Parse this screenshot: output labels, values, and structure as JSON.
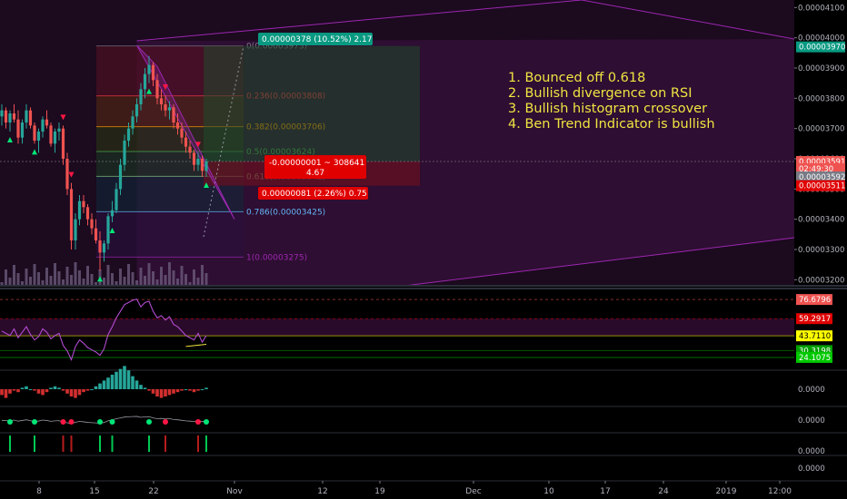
{
  "chart_data": {
    "type": "candlestick",
    "main_axis": {
      "ticks": [
        "0.00004100",
        "0.00004000",
        "0.00003900",
        "0.00003800",
        "0.00003700",
        "0.00003600",
        "0.00003500",
        "0.00003400",
        "0.00003300",
        "0.00003200"
      ],
      "tick_values": [
        4100,
        4000,
        3900,
        3800,
        3700,
        3600,
        3500,
        3400,
        3300,
        3200
      ],
      "scale_note": "values x1e-8"
    },
    "price_badges": [
      {
        "label": "0.00003970",
        "value": 3970,
        "color": "#089981"
      },
      {
        "label": "0.00003591",
        "value": 3591,
        "color": "#ef5350"
      },
      {
        "label": "02:49:30",
        "value": 3567,
        "color": "#ef5350"
      },
      {
        "label": "0.00003592",
        "value": 3540,
        "color": "#787b86"
      },
      {
        "label": "0.00003511",
        "value": 3511,
        "color": "#e00000"
      }
    ],
    "fib_levels": [
      {
        "label": "0(0.00003973)",
        "value": 3973,
        "color": "#787b86"
      },
      {
        "label": "0.236(0.00003808)",
        "value": 3808,
        "color": "#f23645"
      },
      {
        "label": "0.382(0.00003706)",
        "value": 3706,
        "color": "#ff9800"
      },
      {
        "label": "0.5(0.00003624)",
        "value": 3624,
        "color": "#4caf50"
      },
      {
        "label": "0.618(0.00003542)",
        "value": 3542,
        "color": "#81c784"
      },
      {
        "label": "0.786(0.00003425)",
        "value": 3425,
        "color": "#64b5f6"
      },
      {
        "label": "1(0.00003275)",
        "value": 3275,
        "color": "#9c27b0"
      }
    ],
    "position_tool": {
      "target_label": "0.00000378 (10.52%) 2.17",
      "stop_label": "0.00000081 (2.26%) 0.75",
      "ruler_label_line1": "-0.00000001 ~ 308641",
      "ruler_label_line2": "4.67",
      "entry": 3591,
      "target": 3973,
      "stop": 3511
    },
    "candles": [
      [
        3740,
        3780,
        3710,
        3760
      ],
      [
        3760,
        3770,
        3700,
        3720
      ],
      [
        3720,
        3760,
        3690,
        3750
      ],
      [
        3750,
        3780,
        3720,
        3730
      ],
      [
        3730,
        3760,
        3650,
        3670
      ],
      [
        3670,
        3730,
        3650,
        3720
      ],
      [
        3720,
        3780,
        3700,
        3760
      ],
      [
        3760,
        3770,
        3700,
        3710
      ],
      [
        3710,
        3720,
        3650,
        3660
      ],
      [
        3660,
        3700,
        3620,
        3690
      ],
      [
        3690,
        3740,
        3670,
        3730
      ],
      [
        3730,
        3760,
        3700,
        3710
      ],
      [
        3710,
        3720,
        3640,
        3650
      ],
      [
        3650,
        3700,
        3620,
        3690
      ],
      [
        3690,
        3720,
        3660,
        3700
      ],
      [
        3700,
        3710,
        3580,
        3600
      ],
      [
        3600,
        3620,
        3480,
        3500
      ],
      [
        3500,
        3520,
        3300,
        3330
      ],
      [
        3330,
        3420,
        3300,
        3400
      ],
      [
        3400,
        3480,
        3380,
        3460
      ],
      [
        3460,
        3480,
        3420,
        3440
      ],
      [
        3440,
        3450,
        3380,
        3400
      ],
      [
        3400,
        3420,
        3350,
        3370
      ],
      [
        3370,
        3400,
        3320,
        3330
      ],
      [
        3330,
        3360,
        3230,
        3290
      ],
      [
        3290,
        3330,
        3260,
        3320
      ],
      [
        3320,
        3420,
        3300,
        3410
      ],
      [
        3410,
        3460,
        3390,
        3430
      ],
      [
        3430,
        3520,
        3420,
        3500
      ],
      [
        3500,
        3600,
        3480,
        3580
      ],
      [
        3580,
        3680,
        3560,
        3660
      ],
      [
        3660,
        3720,
        3640,
        3700
      ],
      [
        3700,
        3760,
        3680,
        3740
      ],
      [
        3740,
        3800,
        3720,
        3780
      ],
      [
        3780,
        3850,
        3760,
        3830
      ],
      [
        3830,
        3900,
        3800,
        3880
      ],
      [
        3880,
        3940,
        3850,
        3910
      ],
      [
        3910,
        3920,
        3840,
        3860
      ],
      [
        3860,
        3880,
        3780,
        3800
      ],
      [
        3800,
        3830,
        3760,
        3780
      ],
      [
        3780,
        3810,
        3740,
        3760
      ],
      [
        3760,
        3790,
        3730,
        3770
      ],
      [
        3770,
        3780,
        3700,
        3720
      ],
      [
        3720,
        3750,
        3680,
        3700
      ],
      [
        3700,
        3720,
        3650,
        3670
      ],
      [
        3670,
        3690,
        3620,
        3640
      ],
      [
        3640,
        3660,
        3600,
        3620
      ],
      [
        3620,
        3630,
        3560,
        3580
      ],
      [
        3580,
        3620,
        3560,
        3600
      ],
      [
        3600,
        3610,
        3540,
        3560
      ],
      [
        3560,
        3600,
        3540,
        3591
      ]
    ],
    "rsi": {
      "badges": [
        {
          "label": "76.6796",
          "value": 76.68,
          "color": "#ef5350"
        },
        {
          "label": "59.2917",
          "value": 59.29,
          "color": "#e00000"
        },
        {
          "label": "43.7110",
          "value": 43.71,
          "color": "#ffff00"
        },
        {
          "label": "30.3198",
          "value": 30.32,
          "color": "#00a000"
        },
        {
          "label": "24.1075",
          "value": 24.11,
          "color": "#00c800"
        }
      ],
      "values": [
        48,
        46,
        44,
        50,
        42,
        47,
        52,
        45,
        40,
        43,
        50,
        47,
        41,
        44,
        46,
        35,
        30,
        22,
        34,
        40,
        37,
        33,
        31,
        29,
        26,
        32,
        45,
        52,
        60,
        66,
        72,
        74,
        76,
        77,
        70,
        74,
        75,
        66,
        60,
        62,
        58,
        61,
        54,
        52,
        48,
        44,
        42,
        40,
        46,
        38,
        44
      ]
    },
    "histogram": {
      "badge": "0.0000",
      "values": [
        -4,
        -6,
        -3,
        -1,
        -2,
        1,
        2,
        0,
        -1,
        -3,
        -4,
        -2,
        1,
        2,
        1,
        -1,
        -3,
        -5,
        -6,
        -4,
        -2,
        -1,
        0,
        2,
        4,
        6,
        8,
        10,
        12,
        14,
        16,
        13,
        9,
        6,
        3,
        1,
        -1,
        -3,
        -5,
        -6,
        -5,
        -4,
        -3,
        -2,
        -1,
        0,
        -1,
        -2,
        -1,
        0,
        1
      ]
    },
    "ben_trend": {
      "badges": [
        "0.0000",
        "0.0000",
        "0.0000"
      ],
      "signals": [
        {
          "i": 2,
          "dir": "up"
        },
        {
          "i": 8,
          "dir": "up"
        },
        {
          "i": 15,
          "dir": "down"
        },
        {
          "i": 17,
          "dir": "down"
        },
        {
          "i": 24,
          "dir": "up"
        },
        {
          "i": 27,
          "dir": "up"
        },
        {
          "i": 36,
          "dir": "up"
        },
        {
          "i": 40,
          "dir": "down"
        },
        {
          "i": 48,
          "dir": "down"
        },
        {
          "i": 50,
          "dir": "up"
        }
      ]
    },
    "x_axis": {
      "ticks": [
        "8",
        "15",
        "22",
        "Nov",
        "12",
        "19",
        "Dec",
        "10",
        "17",
        "24",
        "2019",
        "12:00"
      ]
    }
  },
  "annotations": [
    "1. Bounced off 0.618",
    "2. Bullish divergence on RSI",
    "3. Bullish histogram crossover",
    "4. Ben Trend Indicator is bullish"
  ],
  "colors": {
    "up": "#26a69a",
    "down": "#ef5350",
    "bg_panel": "#2a0a2a",
    "annotation": "#f0e442"
  }
}
